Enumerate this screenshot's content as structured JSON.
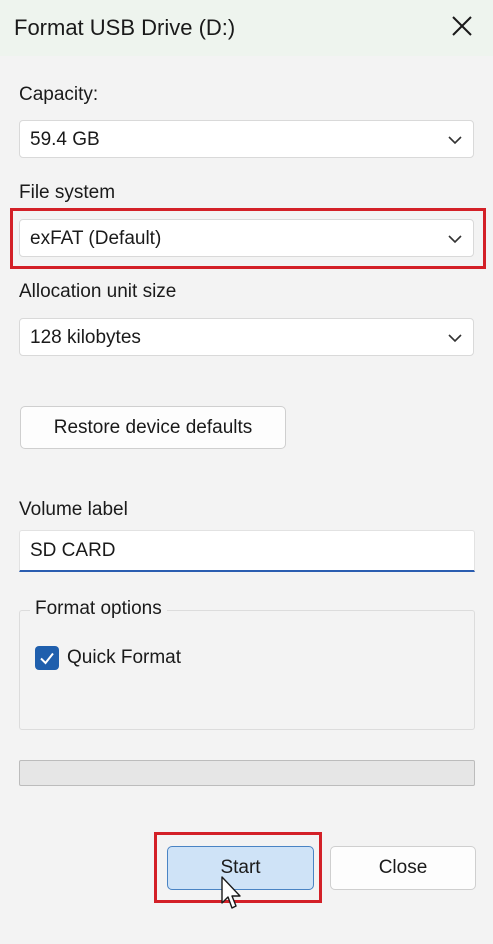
{
  "window": {
    "title": "Format USB Drive (D:)",
    "close_icon": "close-icon"
  },
  "capacity": {
    "label": "Capacity:",
    "value": "59.4 GB"
  },
  "file_system": {
    "label": "File system",
    "value": "exFAT (Default)"
  },
  "allocation": {
    "label": "Allocation unit size",
    "value": "128 kilobytes"
  },
  "restore_button": {
    "label": "Restore device defaults"
  },
  "volume": {
    "label": "Volume label",
    "value": "SD CARD"
  },
  "format_options": {
    "legend": "Format options",
    "quick_format_label": "Quick Format",
    "quick_format_checked": true
  },
  "progress": {
    "fraction": 0
  },
  "actions": {
    "start_label": "Start",
    "close_label": "Close"
  },
  "colors": {
    "accent": "#1f5fad",
    "highlight": "#d32027",
    "start_button_bg": "#cfe3f7"
  }
}
